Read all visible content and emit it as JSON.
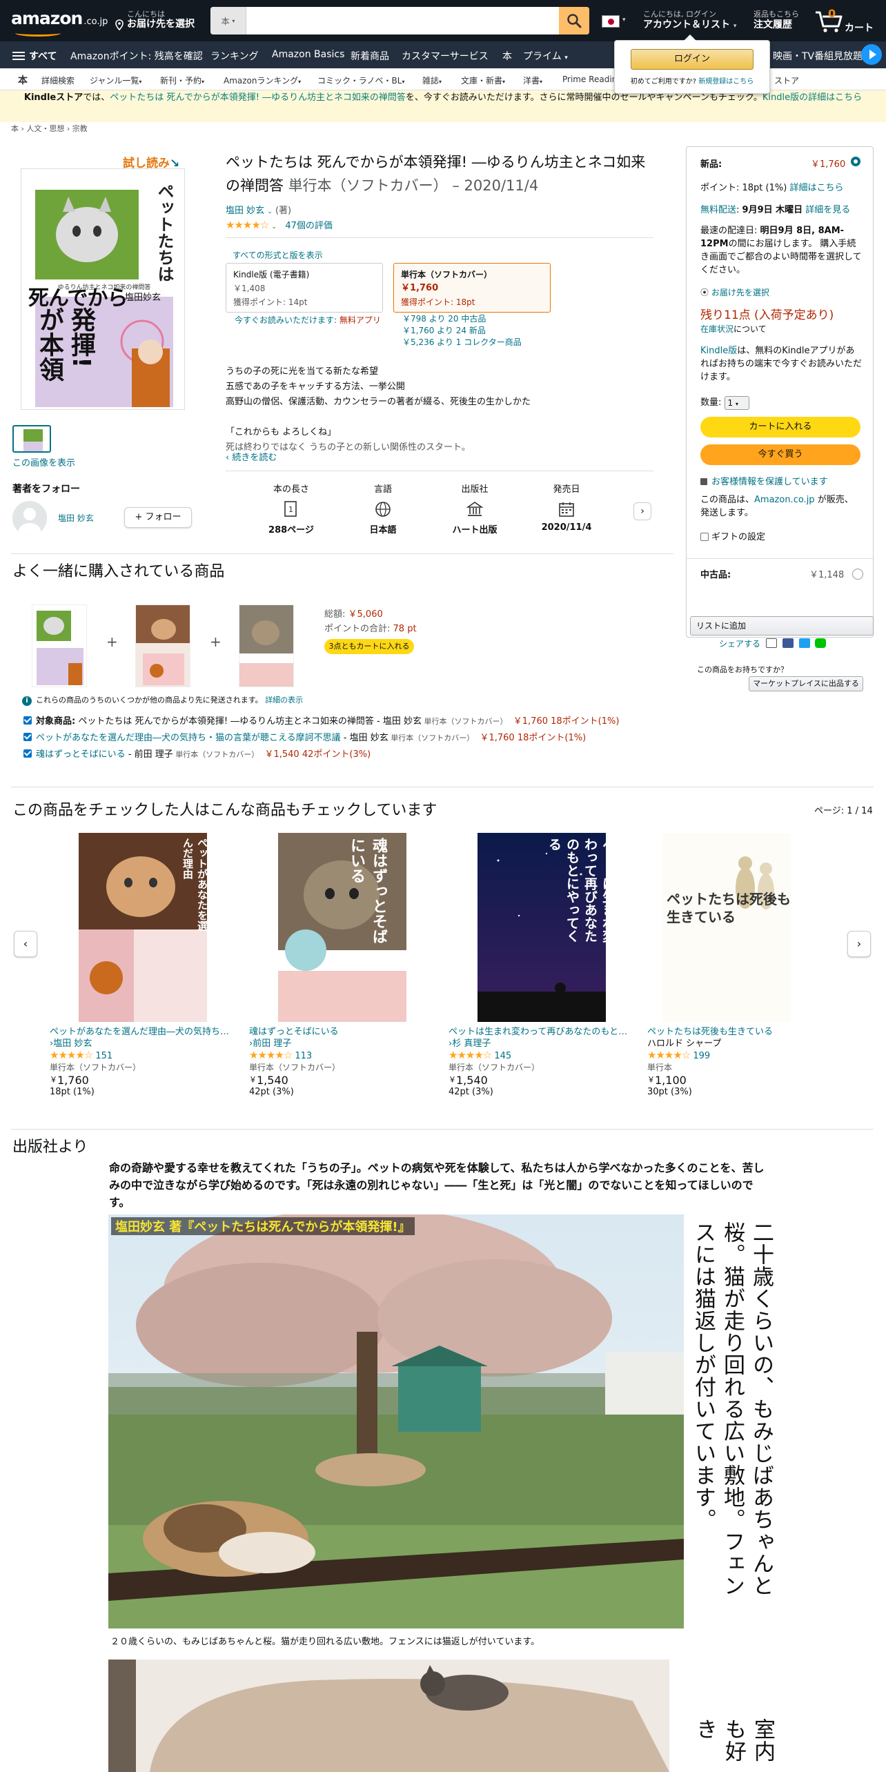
{
  "header": {
    "logo": "amazon",
    "logo_suffix": ".co.jp",
    "deliver_l1": "こんにちは",
    "deliver_l2": "お届け先を選択",
    "search_category": "本",
    "search_placeholder": "",
    "account_l1": "こんにちは, ログイン",
    "account_l2": "アカウント＆リスト",
    "orders_l1": "返品もこちら",
    "orders_l2": "注文履歴",
    "cart_count": "0",
    "cart_label": "カート"
  },
  "nav": {
    "all": "すべて",
    "items": [
      "Amazonポイント: 残高を確認",
      "ランキング",
      "Amazon Basics",
      "新着商品",
      "カスタマーサービス",
      "本",
      "プライム"
    ],
    "prime_video": "映画・TV番組見放題"
  },
  "subnav": [
    "本",
    "詳細検索",
    "ジャンル一覧",
    "新刊・予約",
    "Amazonランキング",
    "コミック・ラノベ・BL",
    "雑誌",
    "文庫・新書",
    "洋書",
    "Prime Readin",
    "ストア"
  ],
  "banner": {
    "prefix": "Kindleストア",
    "t1": "では、",
    "book": "ペットたちは 死んでからが本領発揮! ―ゆるりん坊主とネコ如来の禅問答",
    "t2": "を、今すぐお読みいただけます。さらに常時開催中のセールやキャンペーンもチェック。",
    "link": "Kindle版の詳細はこちら"
  },
  "signin": {
    "button": "ログイン",
    "new_text": "初めてご利用ですか?",
    "new_link": "新規登録はこちら"
  },
  "breadcrumb": "本 › 人文・思想 › 宗教",
  "product": {
    "try_read": "試し読み",
    "cover_title": "ペットたちは死んでからが本領発揮!",
    "cover_sub": "ゆるりん坊主とネコ如来の禅問答",
    "cover_author": "塩田妙玄",
    "view_image": "この画像を表示",
    "title": "ペットたちは 死んでからが本領発揮! ―ゆるりん坊主とネコ如来の禅問答",
    "format_suffix": "単行本（ソフトカバー） – 2020/11/4",
    "author_name": "塩田 妙玄",
    "author_role": "(著)",
    "rating_count": "47個の評価",
    "all_formats": "すべての形式と版を表示",
    "kindle": {
      "label": "Kindle版 (電子書籍)",
      "price": "￥1,408",
      "points": "獲得ポイント: 14pt"
    },
    "paper": {
      "label": "単行本（ソフトカバー）",
      "price": "￥1,760",
      "points": "獲得ポイント: 18pt"
    },
    "kindle_free": "今すぐお読みいただけます:",
    "kindle_free_app": "無料アプリ",
    "offers": [
      "￥798 より 20 中古品",
      "￥1,760 より 24 新品",
      "￥5,236 より 1 コレクター商品"
    ],
    "desc": [
      "うちの子の死に光を当てる新たな希望",
      "五感であの子をキャッチする方法、一挙公開",
      "高野山の僧侶、保護活動、カウンセラーの著者が綴る、死後生の生かしかた",
      "",
      "「これからも よろしくね」",
      "死は終わりではなく うちの子との新しい関係性のスタート。"
    ],
    "read_more": "‹ 続きを読む"
  },
  "follow": {
    "title": "著者をフォロー",
    "name": "塩田 妙玄",
    "button": "+ フォロー"
  },
  "attributes": [
    {
      "h": "本の長さ",
      "v": "288ページ",
      "icon": "pages-icon"
    },
    {
      "h": "言語",
      "v": "日本語",
      "icon": "globe-icon"
    },
    {
      "h": "出版社",
      "v": "ハート出版",
      "icon": "building-icon"
    },
    {
      "h": "発売日",
      "v": "2020/11/4",
      "icon": "calendar-icon"
    }
  ],
  "buybox": {
    "new_label": "新品:",
    "new_price": "￥1,760",
    "points": "ポイント: 18pt (1%)",
    "points_link": "詳細はこちら",
    "free_ship": "無料配送",
    "ship_date": "9月9日 木曜日",
    "ship_link": "詳細を見る",
    "fastest_1": "最速の配達日:",
    "fastest_2": "明日9月 8日, 8AM-12PM",
    "fastest_3": "の間にお届けします。 購入手続き画面でご都合のよい時間帯を選択してください。",
    "deliver_to": "お届け先を選択",
    "stock": "残り11点 (入荷予定あり)",
    "stock_link": "在庫状況",
    "stock_about": "について",
    "kindle_link": "Kindle版",
    "kindle_text": "は、無料のKindleアプリがあればお持ちの端末で今すぐお読みいただけます。",
    "qty_label": "数量:",
    "qty_value": "1",
    "add_cart": "カートに入れる",
    "buy_now": "今すぐ買う",
    "secure": "お客様情報を保護しています",
    "sold_by_1": "この商品は、",
    "sold_by_link": "Amazon.co.jp",
    "sold_by_2": "が販売、発送します。",
    "gift": "ギフトの設定",
    "used_label": "中古品:",
    "used_price": "￥1,148",
    "add_list": "リストに追加",
    "share": "シェアする",
    "have_item": "この商品をお持ちですか？",
    "sell": "マーケットプレイスに出品する"
  },
  "fbt": {
    "title": "よく一緒に購入されている商品",
    "total_label": "総額:",
    "total": "￥5,060",
    "points_label": "ポイントの合計:",
    "points": "78 pt",
    "button": "3点ともカートに入れる",
    "info": "これらの商品のうちのいくつかが他の商品より先に発送されます。",
    "info_link": "詳細の表示",
    "lines": [
      {
        "label": "対象商品:",
        "title": "ペットたちは 死んでからが本領発揮! ―ゆるりん坊主とネコ如来の禅問答",
        "author": " - 塩田 妙玄",
        "fmt": " 単行本（ソフトカバー）",
        "price": "￥1,760 18ポイント(1%)"
      },
      {
        "label": "",
        "title": "ペットがあなたを選んだ理由―犬の気持ち・猫の言葉が聴こえる摩訶不思議",
        "author": " - 塩田 妙玄",
        "fmt": " 単行本（ソフトカバー）",
        "price": "￥1,760 18ポイント(1%)"
      },
      {
        "label": "",
        "title": "魂はずっとそばにいる",
        "author": " - 前田 理子",
        "fmt": " 単行本（ソフトカバー）",
        "price": "￥1,540 42ポイント(3%)"
      }
    ]
  },
  "also_viewed": {
    "title": "この商品をチェックした人はこんな商品もチェックしています",
    "page": "ページ: 1 / 14",
    "items": [
      {
        "title": "ペットがあなたを選んだ理由―犬の気持ち・猫の言葉が聴こえる摩訶不思議",
        "author": "›塩田 妙玄",
        "rating": "151",
        "format": "単行本（ソフトカバー）",
        "price": "1,760",
        "points": "18pt (1%)",
        "cover": "ペットがあなたを選んだ理由"
      },
      {
        "title": "魂はずっとそばにいる",
        "author": "›前田 理子",
        "rating": "113",
        "format": "単行本（ソフトカバー）",
        "price": "1,540",
        "points": "42pt (3%)",
        "cover": "魂はずっとそばにいる"
      },
      {
        "title": "ペットは生まれ変わって再びあなたのもとにやってくる",
        "author": "›杉 真理子",
        "rating": "145",
        "format": "単行本（ソフトカバー）",
        "price": "1,540",
        "points": "42pt (3%)",
        "cover": "ペットは生まれ変わって再びあなたのもとにやってくる"
      },
      {
        "title": "ペットたちは死後も生きている",
        "author": "ハロルド シャープ",
        "rating": "199",
        "format": "単行本",
        "price": "1,100",
        "points": "30pt (3%)",
        "cover": "ペットたちは死後も生きている"
      }
    ]
  },
  "publisher": {
    "title": "出版社より",
    "text": "命の奇跡や愛する幸せを教えてくれた「うちの子」。ペットの病気や死を体験して、私たちは人から学べなかった多くのことを、苦しみの中で泣きながら学び始めるのです。「死は永遠の別れじゃない」――「生と死」は「光と闇」のでないことを知ってほしいのです。",
    "photo_banner": "塩田妙玄 著『ペットたちは死んでからが本領発揮!』",
    "vtext1": "二十歳くらいの、もみじばあちゃんと桜。猫が走り回れる広い敷地。フェンスには猫返しが付いています。",
    "caption1": "２０歳くらいの、もみじばあちゃんと桜。猫が走り回れる広い敷地。フェンスには猫返しが付いています。",
    "vtext2": "室内も好き"
  },
  "colors": {
    "header": "#131921",
    "nav": "#232F3E",
    "accent": "#FF9900",
    "link": "#007185",
    "price": "#B12704",
    "cart_btn": "#FFD814",
    "buy_btn": "#FFA41C"
  }
}
